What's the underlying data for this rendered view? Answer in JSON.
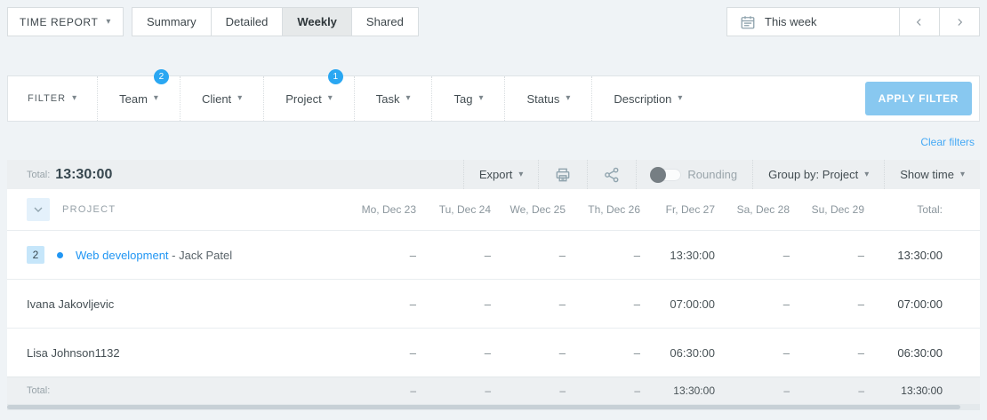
{
  "topbar": {
    "report_type": "TIME REPORT",
    "tabs": [
      {
        "label": "Summary"
      },
      {
        "label": "Detailed"
      },
      {
        "label": "Weekly"
      },
      {
        "label": "Shared"
      }
    ],
    "date_range": "This week"
  },
  "filters": {
    "label": "FILTER",
    "items": [
      {
        "label": "Team",
        "badge": "2"
      },
      {
        "label": "Client"
      },
      {
        "label": "Project",
        "badge": "1"
      },
      {
        "label": "Task"
      },
      {
        "label": "Tag"
      },
      {
        "label": "Status"
      },
      {
        "label": "Description"
      }
    ],
    "apply_label": "APPLY FILTER",
    "clear_label": "Clear filters"
  },
  "toolbar": {
    "total_label": "Total:",
    "total_value": "13:30:00",
    "export_label": "Export",
    "rounding_label": "Rounding",
    "group_by_label": "Group by: Project",
    "show_time_label": "Show time"
  },
  "table": {
    "project_header": "PROJECT",
    "day_headers": [
      "Mo, Dec 23",
      "Tu, Dec 24",
      "We, Dec 25",
      "Th, Dec 26",
      "Fr, Dec 27",
      "Sa, Dec 28",
      "Su, Dec 29"
    ],
    "total_header": "Total:",
    "rows": [
      {
        "badge": "2",
        "project": "Web development",
        "suffix": "- Jack Patel",
        "values": [
          "–",
          "–",
          "–",
          "–",
          "13:30:00",
          "–",
          "–"
        ],
        "total": "13:30:00"
      },
      {
        "name": "Ivana Jakovljevic",
        "values": [
          "–",
          "–",
          "–",
          "–",
          "07:00:00",
          "–",
          "–"
        ],
        "total": "07:00:00"
      },
      {
        "name": "Lisa Johnson1132",
        "values": [
          "–",
          "–",
          "–",
          "–",
          "06:30:00",
          "–",
          "–"
        ],
        "total": "06:30:00"
      }
    ],
    "footer": {
      "label": "Total:",
      "values": [
        "–",
        "–",
        "–",
        "–",
        "13:30:00",
        "–",
        "–"
      ],
      "total": "13:30:00"
    }
  },
  "colors": {
    "accent_blue": "#2aa7f2",
    "link_blue": "#2196f3",
    "apply_button": "#88c8f0",
    "toolbar_gray": "#eceff1",
    "page_bg": "#eff3f6"
  }
}
